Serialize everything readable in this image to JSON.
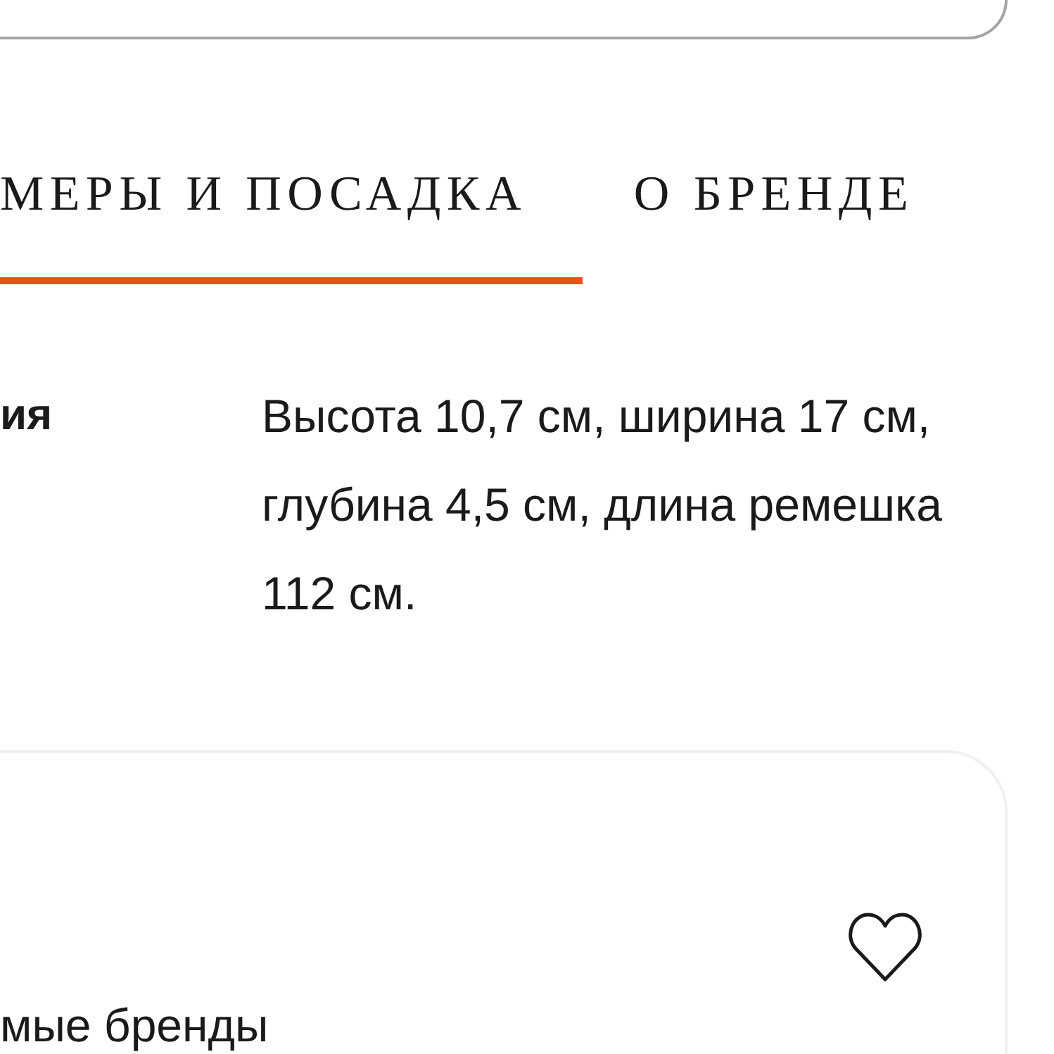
{
  "tabs": [
    {
      "label": "МЕРЫ И ПОСАДКА",
      "selected": true
    },
    {
      "label": "О БРЕНДЕ",
      "selected": false
    }
  ],
  "details": [
    {
      "label": "ия",
      "value": "Высота 10,7 см, ширина 17 см, глубина 4,5 см, длина ремешка 112 см."
    }
  ],
  "card": {
    "favorite": false,
    "text": "мые бренды"
  }
}
